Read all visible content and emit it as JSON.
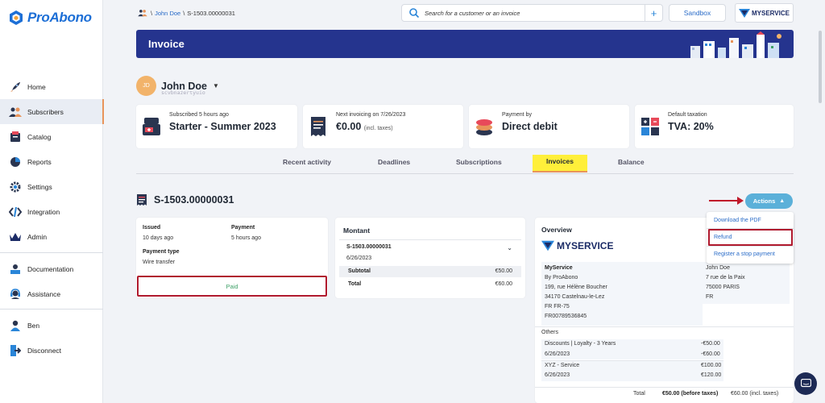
{
  "brand": {
    "name": "ProAbono",
    "color": "#1d6fd6"
  },
  "sidebar": {
    "items": [
      {
        "label": "Home",
        "icon": "rocket-icon"
      },
      {
        "label": "Subscribers",
        "icon": "users-icon",
        "active": true
      },
      {
        "label": "Catalog",
        "icon": "catalog-icon"
      },
      {
        "label": "Reports",
        "icon": "pie-chart-icon"
      },
      {
        "label": "Settings",
        "icon": "gear-icon"
      },
      {
        "label": "Integration",
        "icon": "code-icon"
      },
      {
        "label": "Admin",
        "icon": "crown-icon"
      }
    ],
    "help": [
      {
        "label": "Documentation",
        "icon": "book-icon"
      },
      {
        "label": "Assistance",
        "icon": "headset-icon"
      }
    ],
    "account": [
      {
        "label": "Ben",
        "icon": "user-icon"
      },
      {
        "label": "Disconnect",
        "icon": "logout-icon"
      }
    ]
  },
  "topbar": {
    "breadcrumb_sep1": "\\",
    "breadcrumb_customer": "John Doe",
    "breadcrumb_sep2": "\\",
    "breadcrumb_invoice": "S-1503.00000031",
    "search_placeholder": "Search for a customer or an invoice",
    "search_add": "+",
    "sandbox_label": "Sandbox",
    "brand_button": "MYSERVICE"
  },
  "banner": {
    "title": "Invoice"
  },
  "customer": {
    "initials": "JD",
    "name": "John Doe",
    "sub": "scvbnazertyuio"
  },
  "stats": [
    {
      "label": "Subscribed 5 hours ago",
      "value": "Starter - Summer 2023",
      "icon": "register-icon"
    },
    {
      "label": "Next invoicing on 7/26/2023",
      "value": "€0.00",
      "suffix": "(incl. taxes)",
      "icon": "receipt-icon"
    },
    {
      "label": "Payment by",
      "value": "Direct debit",
      "icon": "coins-icon"
    },
    {
      "label": "Default taxation",
      "value": "TVA: 20%",
      "icon": "calculator-icon"
    }
  ],
  "tabs": [
    {
      "label": "Recent activity"
    },
    {
      "label": "Deadlines"
    },
    {
      "label": "Subscriptions"
    },
    {
      "label": "Invoices",
      "active": true
    },
    {
      "label": "Balance"
    }
  ],
  "invoice": {
    "number": "S-1503.00000031",
    "actions_label": "Actions",
    "issued_label": "Issued",
    "issued_value": "10 days ago",
    "payment_label": "Payment",
    "payment_value": "5 hours ago",
    "payment_type_label": "Payment type",
    "payment_type_value": "Wire transfer",
    "status": "Paid"
  },
  "montant": {
    "title": "Montant",
    "ref": "S-1503.00000031",
    "date": "6/26/2023",
    "subtotal_label": "Subtotal",
    "subtotal_value": "€50.00",
    "total_label": "Total",
    "total_value": "€60.00"
  },
  "actions_menu": {
    "download": "Download the PDF",
    "refund": "Refund",
    "stop_payment": "Register a stop payment"
  },
  "overview": {
    "title": "Overview",
    "logo_text": "MYSERVICE",
    "seller": [
      "MyService",
      "By ProAbono",
      "199, rue Hélène Boucher",
      "34170   Castelnau-le-Lez",
      "FR   FR-75",
      "FR00789536845"
    ],
    "buyer": [
      "John Doe",
      "7 rue de la Paix",
      "75000   PARIS",
      "FR"
    ],
    "others_label": "Others",
    "lines": [
      {
        "label": "Discounts | Loyalty - 3 Years",
        "value": "-€50.00"
      },
      {
        "label": "6/26/2023",
        "value": "-€60.00"
      },
      {
        "label": "XYZ - Service",
        "value": "€100.00"
      },
      {
        "label": "6/26/2023",
        "value": "€120.00"
      }
    ],
    "total_label": "Total",
    "total_before": "€50.00",
    "total_before_label": "(before taxes)",
    "total_incl": "€60.00",
    "total_incl_label": "(incl. taxes)"
  }
}
